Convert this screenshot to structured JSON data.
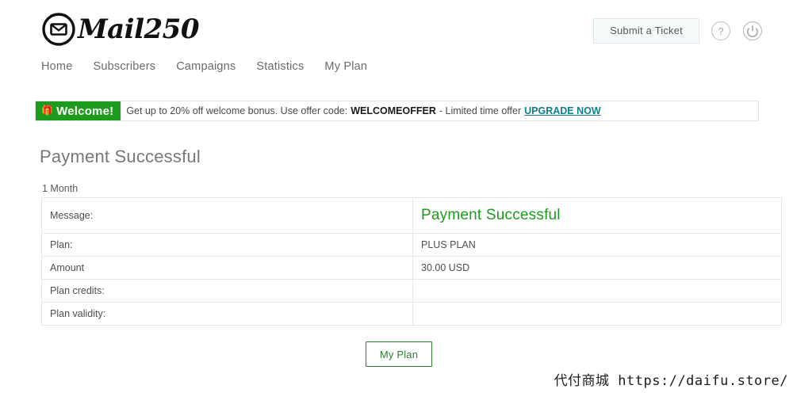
{
  "brand": {
    "name": "Mail250",
    "logo_icon": "envelope-in-circle-icon"
  },
  "header": {
    "submit_ticket_label": "Submit a Ticket",
    "help_icon": "question-mark-circle-icon",
    "power_icon": "power-circle-icon",
    "nav": [
      {
        "label": "Home"
      },
      {
        "label": "Subscribers"
      },
      {
        "label": "Campaigns"
      },
      {
        "label": "Statistics"
      },
      {
        "label": "My Plan"
      }
    ]
  },
  "banner": {
    "badge_icon": "gift-icon",
    "badge_label": "Welcome!",
    "text_before_code": "Get up to 20% off welcome bonus. Use offer code:",
    "code": "WELCOMEOFFER",
    "text_after_code": "- Limited time offer",
    "link_label": "UPGRADE NOW",
    "badge_color": "#1d9b1d",
    "link_color": "#0e7f8c"
  },
  "main": {
    "title": "Payment Successful",
    "term_label": "1 Month",
    "table": {
      "rows": [
        {
          "label": "Message:",
          "value": "Payment Successful"
        },
        {
          "label": "Plan:",
          "value": "PLUS PLAN"
        },
        {
          "label": "Amount",
          "value": "30.00 USD"
        },
        {
          "label": "Plan credits:",
          "value": ""
        },
        {
          "label": "Plan validity:",
          "value": ""
        }
      ]
    },
    "my_plan_button_label": "My Plan",
    "success_color": "#1d9b1d"
  },
  "watermark": {
    "text": "代付商城 https://daifu.store/"
  }
}
